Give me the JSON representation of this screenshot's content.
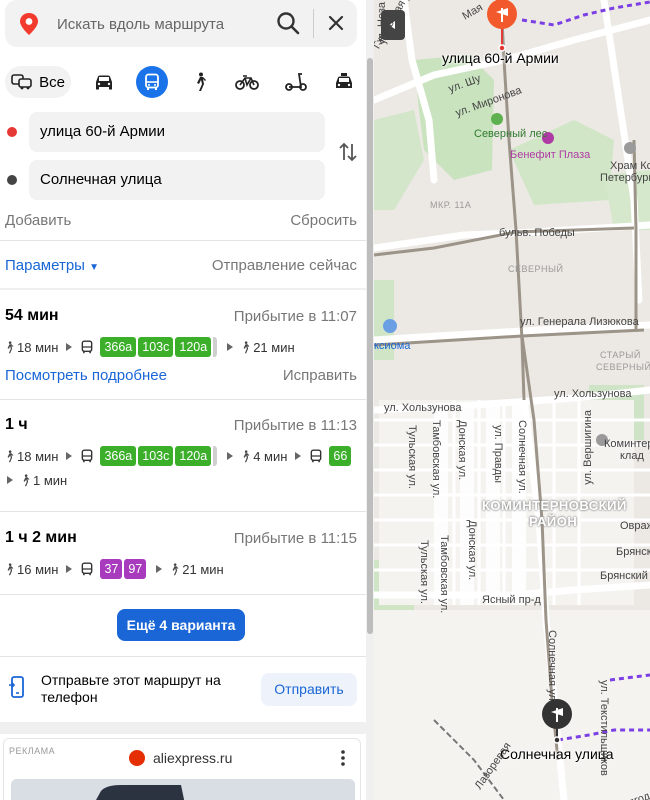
{
  "search": {
    "placeholder": "Искать вдоль маршрута"
  },
  "modes": {
    "all_label": "Все",
    "selected": "public-transport"
  },
  "waypoints": {
    "from": {
      "label": "улица 60-й Армии",
      "color": "#e53935"
    },
    "to": {
      "label": "Солнечная улица",
      "color": "#444444"
    }
  },
  "actions": {
    "add": "Добавить",
    "reset": "Сбросить"
  },
  "params": {
    "label": "Параметры",
    "departure": "Отправление сейчас"
  },
  "routes": [
    {
      "duration": "54 мин",
      "arrival": "Прибытие в 11:07",
      "walk_start": "18 мин",
      "buses": [
        "366а",
        "103с",
        "120а"
      ],
      "walk_end": "21 мин",
      "details": "Посмотреть подробнее",
      "fix": "Исправить"
    },
    {
      "duration": "1 ч",
      "arrival": "Прибытие в 11:13",
      "walk_start": "18 мин",
      "buses": [
        "366а",
        "103с",
        "120а"
      ],
      "walk_mid": "4 мин",
      "buses2": [
        "66"
      ],
      "walk_end": "1 мин"
    },
    {
      "duration": "1 ч 2 мин",
      "arrival": "Прибытие в 11:15",
      "walk_start": "16 мин",
      "buses": [
        "37",
        "97"
      ],
      "walk_end": "21 мин"
    }
  ],
  "more_variants": "Ещё 4 варианта",
  "send_to_phone": {
    "text": "Отправьте этот маршрут на телефон",
    "button": "Отправить"
  },
  "ad": {
    "tag": "РЕКЛАМА",
    "domain": "aliexpress.ru"
  },
  "colors": {
    "accent": "#1a66d6",
    "bus_green": "#3bae2a",
    "bus_purple": "#a83bbd",
    "route_line": "#7b3fe4"
  },
  "map": {
    "start_label": "улица 60-й Армии",
    "end_label": "Солнечная улица",
    "districts": [
      "КОМИНТЕРНОВСКИЙ",
      "РАЙОН",
      "СЕВЕРНЫЙ",
      "СТАРЫЙ",
      "СЕВЕРНЫЙ",
      "МКР. 11А"
    ],
    "pois": [
      "Северный лес",
      "Бенефит Плаза",
      "Храм Ксении",
      "Петербургской",
      "Коминтер",
      "клад",
      "ксиома"
    ],
    "streets": [
      "бульв. Победы",
      "ул. Генерала Лизюкова",
      "ул. Хользунова",
      "ул. Хользунова",
      "Солнечная ул.",
      "ул. Вершигина",
      "Тульская ул.",
      "Тамбовская ул.",
      "Донская ул.",
      "ул. Правды",
      "Донская ул.",
      "Тамбовская ул.",
      "Тульская ул.",
      "Ясный пр-д",
      "Солнечная ул.",
      "Брянская",
      "Брянский пр-д",
      "Овраж",
      "ул. Текстильщиков",
      "Гжельская ул.",
      "ул. Шу",
      "ул. Миронова",
      "Мая",
      "ул. Неза",
      "Лазоревая",
      "Волгодонская"
    ]
  }
}
